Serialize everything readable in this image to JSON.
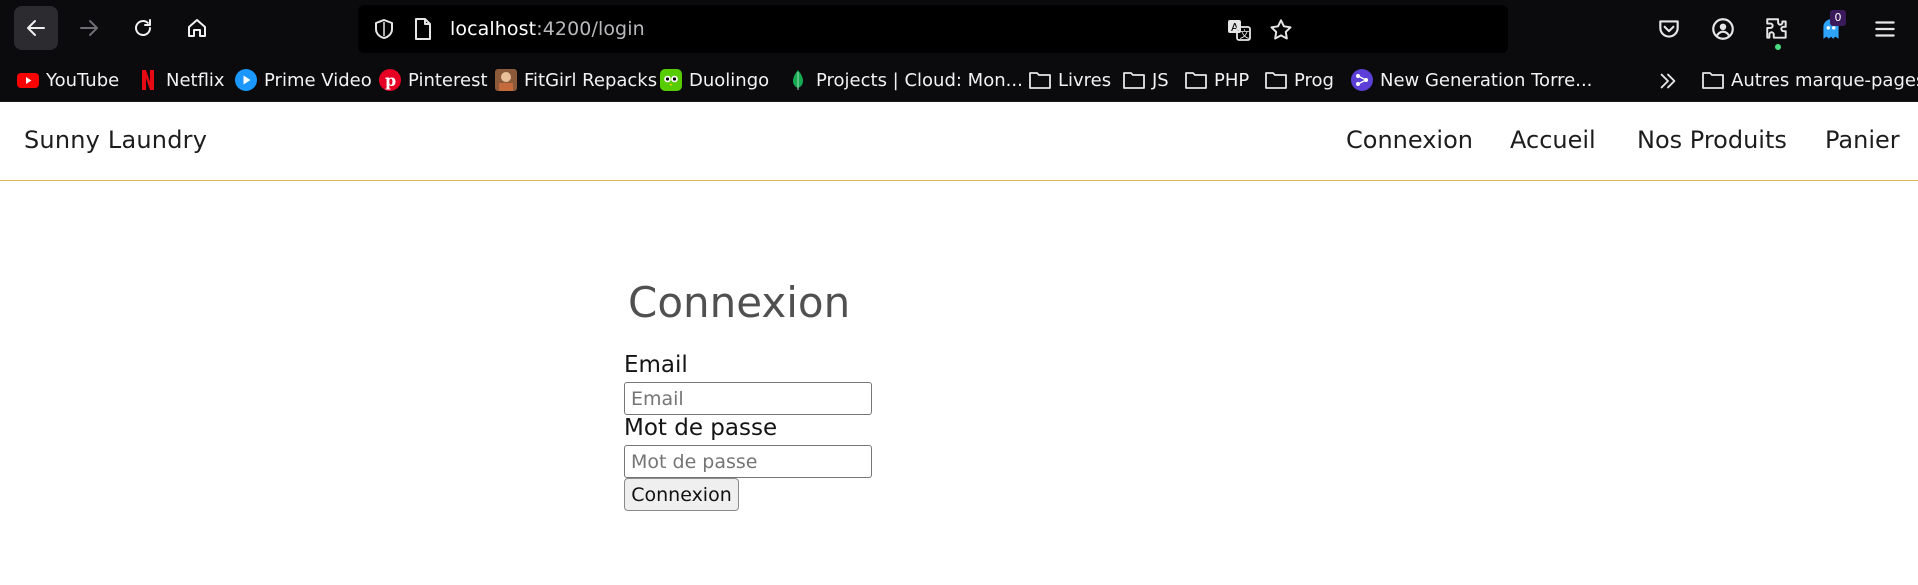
{
  "browser": {
    "url_host": "localhost",
    "url_path": ":4200/login",
    "pocket_badge": "0",
    "bookmarks": [
      {
        "label": "YouTube",
        "icon": "youtube-icon"
      },
      {
        "label": "Netflix",
        "icon": "netflix-icon"
      },
      {
        "label": "Prime Video",
        "icon": "prime-video-icon"
      },
      {
        "label": "Pinterest",
        "icon": "pinterest-icon"
      },
      {
        "label": "FitGirl Repacks",
        "icon": "fitgirl-icon"
      },
      {
        "label": "Duolingo",
        "icon": "duolingo-icon"
      },
      {
        "label": "Projects | Cloud: Mon...",
        "icon": "mongodb-icon"
      },
      {
        "label": "Livres",
        "icon": "folder-icon"
      },
      {
        "label": "JS",
        "icon": "folder-icon"
      },
      {
        "label": "PHP",
        "icon": "folder-icon"
      },
      {
        "label": "Prog",
        "icon": "folder-icon"
      },
      {
        "label": "New Generation Torre...",
        "icon": "torrent-icon"
      }
    ],
    "other_bookmarks": "Autres marque-pages"
  },
  "site": {
    "brand": "Sunny Laundry",
    "nav": [
      "Connexion",
      "Accueil",
      "Nos Produits",
      "Panier"
    ],
    "accent_color": "#e0b85a"
  },
  "login": {
    "title": "Connexion",
    "email_label": "Email",
    "email_placeholder": "Email",
    "email_value": "",
    "password_label": "Mot de passe",
    "password_placeholder": "Mot de passe",
    "password_value": "",
    "submit_label": "Connexion"
  }
}
